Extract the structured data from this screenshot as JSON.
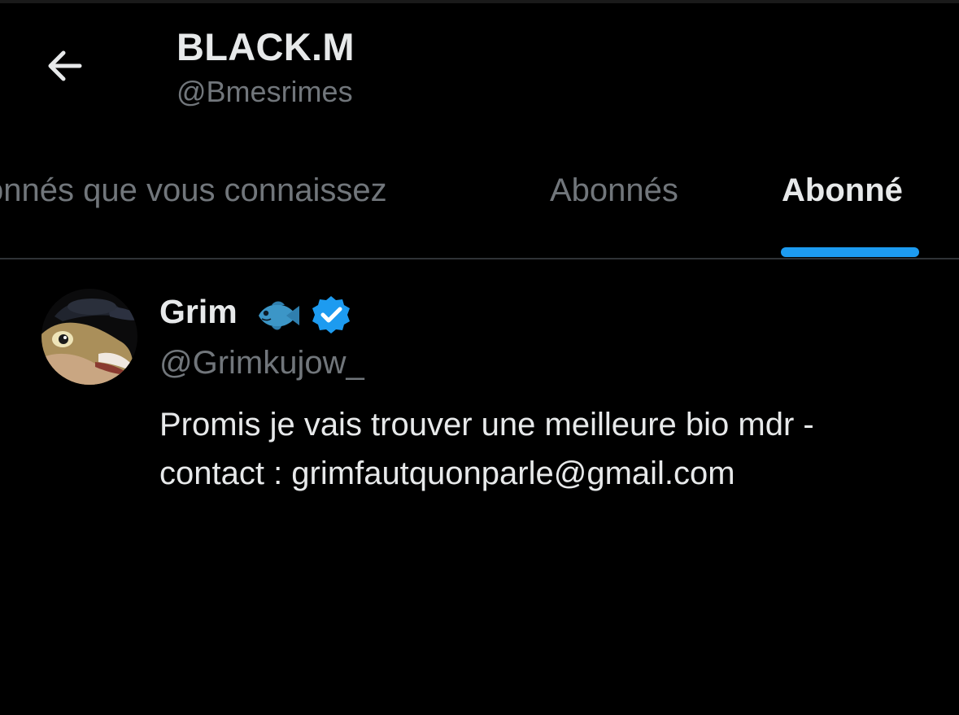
{
  "header": {
    "back_icon": "arrow-left-icon",
    "title": "BLACK.M",
    "handle": "@Bmesrimes"
  },
  "tabs": [
    {
      "label": "Abonnés que vous connaissez",
      "visible_text": "onnés que vous connaissez",
      "active": false
    },
    {
      "label": "Abonnés",
      "active": false
    },
    {
      "label": "Abonné",
      "active": true
    }
  ],
  "accent_color": "#1d9bf0",
  "users": [
    {
      "name": "Grim",
      "emoji_icon": "fish-icon",
      "badge_icon": "verified-badge-icon",
      "handle": "@Grimkujow_",
      "bio_line1": "Promis je vais trouver une meilleure bio mdr -",
      "bio_line2": "contact : grimfautquonparle@gmail.com"
    }
  ]
}
